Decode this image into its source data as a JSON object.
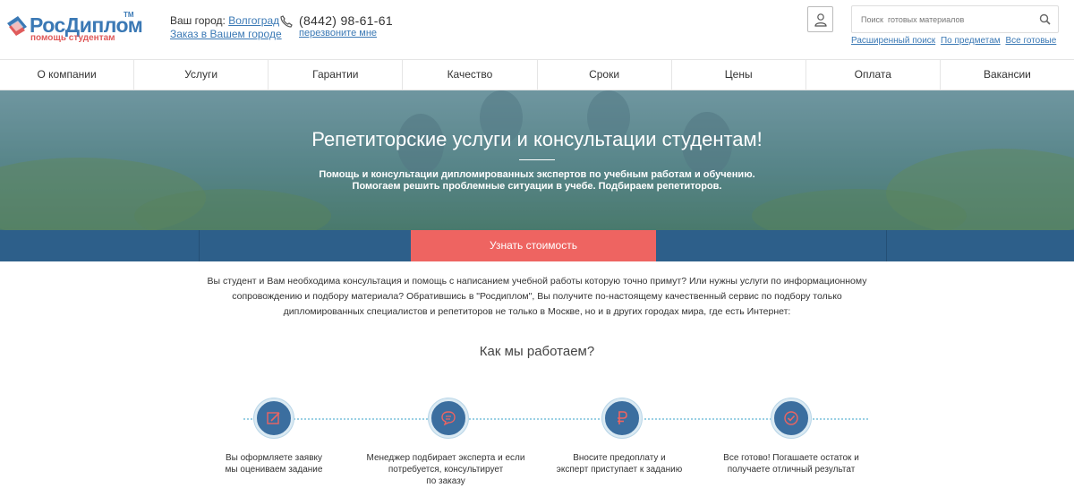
{
  "header": {
    "logo_title": "РосДиплом",
    "logo_tm": "TM",
    "logo_sub": "помощь студентам",
    "city_label": "Ваш город:",
    "city_value": "Волгоград",
    "order_city_link": "Заказ в Вашем городе",
    "phone": "(8442) 98-61-61",
    "callback_link": "перезвоните мне",
    "search_placeholder": "Поиск  готовых материалов",
    "search_links": [
      "Расширенный поиск",
      "По предметам",
      "Все готовые"
    ]
  },
  "nav": {
    "items": [
      "О компании",
      "Услуги",
      "Гарантии",
      "Качество",
      "Сроки",
      "Цены",
      "Оплата",
      "Вакансии"
    ]
  },
  "hero": {
    "title": "Репетиторские услуги и консультации студентам!",
    "line1": "Помощь и консультации дипломированных экспертов по учебным работам и обучению.",
    "line2": "Помогаем решить проблемные ситуации в учебе. Подбираем репетиторов.",
    "cta": "Узнать стоимость"
  },
  "intro": {
    "line1": "Вы студент и Вам необходима консультация и помощь с написанием учебной работы которую точно примут? Или нужны услуги по информационному",
    "line2": "сопровождению и подбору материала? Обратившись в \"Росдиплом\", Вы получите по-настоящему качественный сервис по подбору только",
    "line3": "дипломированных специалистов и репетиторов не только в Москве, но и в других городах мира, где есть Интернет:"
  },
  "how": {
    "title": "Как мы работаем?",
    "steps": [
      {
        "icon": "edit-icon",
        "line1": "Вы оформляете заявку",
        "line2": "мы оцениваем задание",
        "line3": ""
      },
      {
        "icon": "chat-icon",
        "line1": "Менеджер подбирает эксперта и если",
        "line2": "потребуется, консультирует",
        "line3": "по заказу"
      },
      {
        "icon": "ruble-icon",
        "line1": "Вносите предоплату и",
        "line2": "эксперт приступает к заданию",
        "line3": ""
      },
      {
        "icon": "check-icon",
        "line1": "Все готово! Погашаете остаток и",
        "line2": "получаете отличный результат",
        "line3": ""
      }
    ]
  },
  "colors": {
    "brand_blue": "#3b79b5",
    "accent_red": "#ee6461",
    "band_blue": "#2d5f8a"
  }
}
